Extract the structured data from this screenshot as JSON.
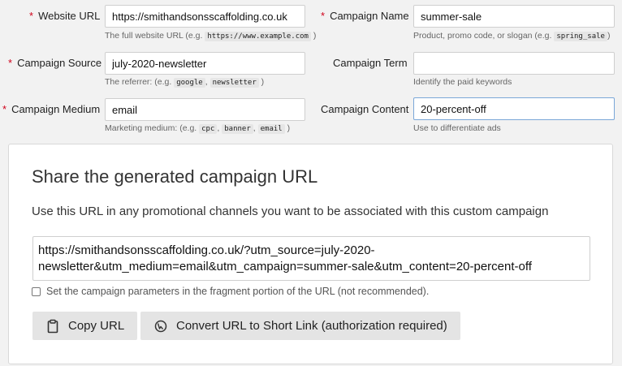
{
  "form": {
    "website_url": {
      "label": "Website URL",
      "value": "https://smithandsonsscaffolding.co.uk",
      "help_prefix": "The full website URL (e.g. ",
      "help_code": "https://www.example.com",
      "help_suffix": ")"
    },
    "campaign_name": {
      "label": "Campaign Name",
      "value": "summer-sale",
      "help_prefix": "Product, promo code, or slogan (e.g. ",
      "help_code": "spring_sale",
      "help_suffix": ")"
    },
    "campaign_source": {
      "label": "Campaign Source",
      "value": "july-2020-newsletter",
      "help_prefix": "The referrer: (e.g. ",
      "help_code_1": "google",
      "help_sep": ", ",
      "help_code_2": "newsletter",
      "help_suffix": ")"
    },
    "campaign_term": {
      "label": "Campaign Term",
      "value": "",
      "help": "Identify the paid keywords"
    },
    "campaign_medium": {
      "label": "Campaign Medium",
      "value": "email",
      "help_prefix": "Marketing medium: (e.g. ",
      "help_code_1": "cpc",
      "help_sep_1": ", ",
      "help_code_2": "banner",
      "help_sep_2": ", ",
      "help_code_3": "email",
      "help_suffix": ")"
    },
    "campaign_content": {
      "label": "Campaign Content",
      "value": "20-percent-off",
      "help": "Use to differentiate ads"
    },
    "required_marker": "*"
  },
  "share": {
    "title": "Share the generated campaign URL",
    "description": "Use this URL in any promotional channels you want to be associated with this custom campaign",
    "generated_url": "https://smithandsonsscaffolding.co.uk/?utm_source=july-2020-newsletter&utm_medium=email&utm_campaign=summer-sale&utm_content=20-percent-off",
    "fragment_option": "Set the campaign parameters in the fragment portion of the URL (not recommended).",
    "fragment_checked": false,
    "copy_button": "Copy URL",
    "short_link_button": "Convert URL to Short Link (authorization required)"
  },
  "icons": {
    "copy": "clipboard-icon",
    "short_link": "link-shortener-icon"
  },
  "colors": {
    "required": "#d0021b",
    "focus_border": "#7aa7d8",
    "button_bg": "#e4e4e4"
  }
}
